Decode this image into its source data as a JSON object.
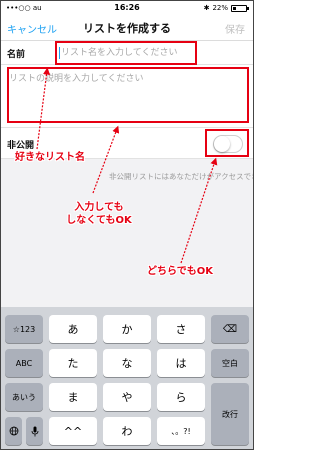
{
  "status_bar": {
    "carrier": "•••○○ au",
    "time": "16:26",
    "battery": "22%",
    "battery_level": 0.22
  },
  "nav": {
    "cancel": "キャンセル",
    "title": "リストを作成する",
    "save": "保存"
  },
  "form": {
    "name_label": "名前",
    "name_placeholder": "リスト名を入力してください",
    "description_placeholder": "リストの説明を入力してください",
    "private_label": "非公開",
    "private_help": "非公開リストにはあなただけがアクセスできます",
    "private_on": false
  },
  "annotations": {
    "color": "#e60012",
    "name_note": "好きなリスト名",
    "description_note_line1": "入力しても",
    "description_note_line2": "しなくてもOK",
    "private_note": "どちらでもOK"
  },
  "keyboard": {
    "row1": [
      "☆123",
      "あ",
      "か",
      "さ",
      "⌫"
    ],
    "row2": [
      "ABC",
      "た",
      "な",
      "は",
      "空白"
    ],
    "row3": [
      "あいう",
      "ま",
      "や",
      "ら",
      "改行"
    ],
    "row4": [
      "globe",
      "mic",
      "^^",
      "わ",
      "、。?!"
    ]
  },
  "colors": {
    "accent": "#1da1f2",
    "keyboard_bg": "#d1d4d9",
    "function_key": "#abb0ba"
  }
}
